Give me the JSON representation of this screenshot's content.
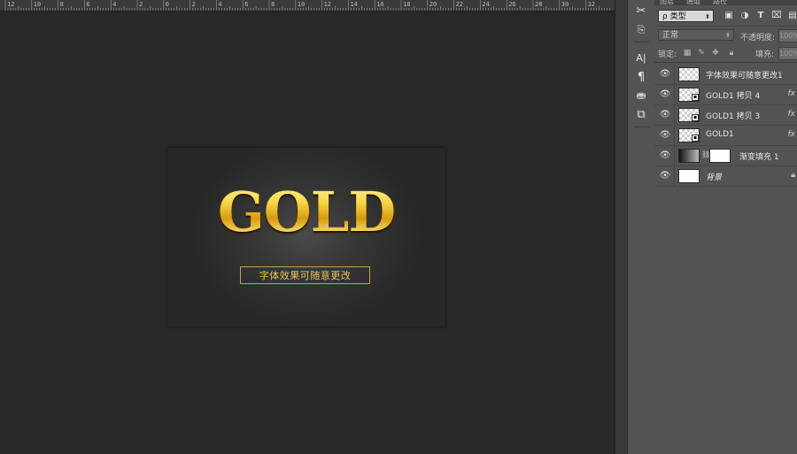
{
  "ruler": {
    "labels": [
      "12",
      "10",
      "8",
      "6",
      "4",
      "2",
      "0",
      "2",
      "4",
      "6",
      "8",
      "10",
      "12",
      "14",
      "16",
      "18",
      "20",
      "22",
      "24",
      "26",
      "28",
      "30",
      "32"
    ]
  },
  "document": {
    "headline": "GOLD",
    "caption": "字体效果可随意更改"
  },
  "tools": [
    {
      "icon": "scissors-tool-icon",
      "glyph": "✂"
    },
    {
      "icon": "properties-tool-icon",
      "glyph": "⎘"
    },
    {
      "icon": "character-panel-icon",
      "glyph": "A|"
    },
    {
      "icon": "paragraph-panel-icon",
      "glyph": "¶"
    },
    {
      "icon": "3d-panel-icon",
      "glyph": "⛂"
    },
    {
      "icon": "clone-source-icon",
      "glyph": "⧉"
    }
  ],
  "panel": {
    "tabs": [
      "图层",
      "通道",
      "路径"
    ],
    "filter": {
      "value": "ρ 类型"
    },
    "blend": {
      "value": "正常",
      "opacity_label": "不透明度:",
      "opacity_value": "100%"
    },
    "lock": {
      "label": "锁定:",
      "fill_label": "填充:",
      "fill_value": "100%"
    },
    "layers": [
      {
        "name": "字体效果可随意更改1",
        "thumb": "checker",
        "fx": false
      },
      {
        "name": "GOLD1 拷贝 4",
        "thumb": "checker",
        "smart": true,
        "fx": true
      },
      {
        "name": "GOLD1 拷贝 3",
        "thumb": "checker",
        "smart": true,
        "fx": true
      },
      {
        "name": "GOLD1",
        "thumb": "checker",
        "smart": true,
        "fx": true
      },
      {
        "name": "渐变填充 1",
        "thumb": "gradient",
        "mask": true,
        "fx": false
      },
      {
        "name": "背景",
        "thumb": "white",
        "locked": true,
        "fx": false
      }
    ],
    "fx_label": "fx"
  }
}
